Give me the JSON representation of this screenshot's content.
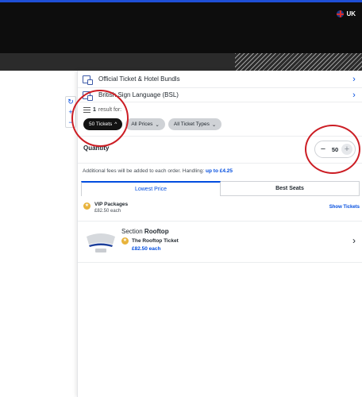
{
  "header": {
    "locale_label": "UK",
    "flag_icon": "uk-flag-icon"
  },
  "map_controls": {
    "reset": "↻",
    "zoom_in": "+",
    "zoom_out": "−"
  },
  "rows": [
    {
      "label": "Official Ticket & Hotel Bundls"
    },
    {
      "label": "British Sign Language (BSL)"
    }
  ],
  "results": {
    "count": "1",
    "text": "result for:"
  },
  "filters": {
    "tickets": "50 Tickets",
    "prices": "All Prices",
    "types": "All Ticket Types"
  },
  "quantity": {
    "label": "Quantity",
    "value": "50",
    "minus": "−",
    "plus": "+"
  },
  "fees": {
    "text": "Additional fees will be added to each order. Handling:",
    "amount": "up to £4.25"
  },
  "tabs": {
    "lowest": "Lowest Price",
    "best": "Best Seats"
  },
  "vip": {
    "title": "VIP Packages",
    "price": "£82.50 each",
    "action": "Show Tickets"
  },
  "listing": {
    "section_prefix": "Section",
    "section_name": "Rooftop",
    "ticket_name": "The Rooftop Ticket",
    "price": "£82.50 each"
  },
  "colors": {
    "accent": "#024ddf",
    "annotation": "#cc1d24",
    "header_bg": "#0d0d0d",
    "star": "#e8b33b"
  }
}
